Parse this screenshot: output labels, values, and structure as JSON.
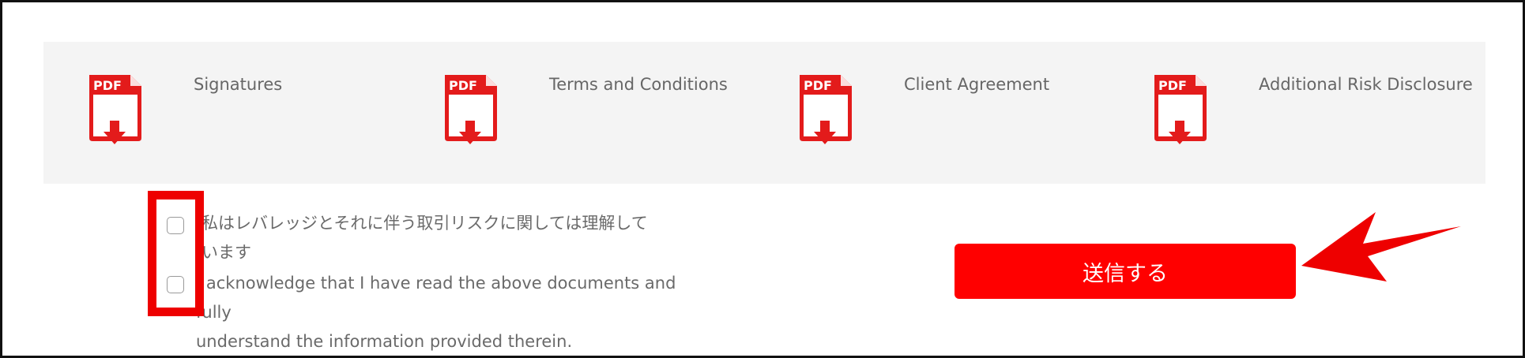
{
  "documents": [
    {
      "title": "Signatures",
      "icon": "pdf-download-icon",
      "icon_label": "PDF"
    },
    {
      "title": "Terms and Conditions",
      "icon": "pdf-download-icon",
      "icon_label": "PDF"
    },
    {
      "title": "Client Agreement",
      "icon": "pdf-download-icon",
      "icon_label": "PDF"
    },
    {
      "title": "Additional Risk Disclosure",
      "icon": "pdf-download-icon",
      "icon_label": "PDF"
    }
  ],
  "acknowledgements": {
    "leverage_line1": "私はレバレッジとそれに伴う取引リスクに関しては理解して",
    "leverage_line2": "います",
    "documents_line1": "I acknowledge that I have read the above documents and fully",
    "documents_line2": "understand the information provided therein."
  },
  "submit": {
    "label": "送信する"
  },
  "colors": {
    "accent": "#ff0000",
    "annotation": "#ee0000",
    "panel_bg": "#f4f4f4",
    "text_gray": "#666666"
  }
}
